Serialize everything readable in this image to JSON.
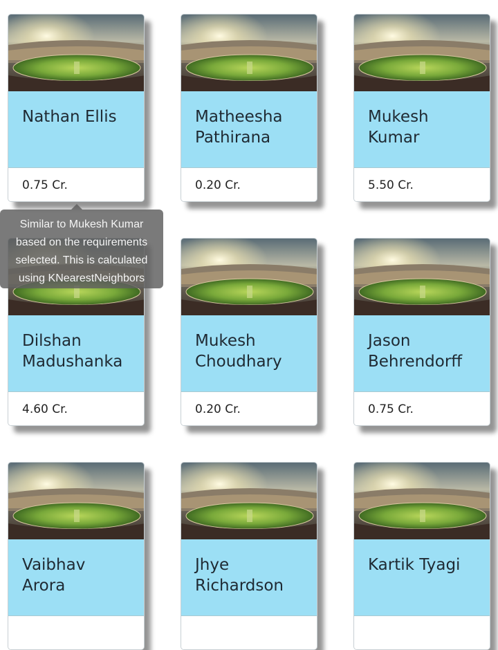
{
  "cards": [
    {
      "name": "Nathan Ellis",
      "price": "0.75 Cr.",
      "image": "stadium-image"
    },
    {
      "name": "Matheesha Pathirana",
      "price": "0.20 Cr.",
      "image": "stadium-image"
    },
    {
      "name": "Mukesh Kumar",
      "price": "5.50 Cr.",
      "image": "stadium-image"
    },
    {
      "name": "Dilshan Madushanka",
      "price": "4.60 Cr.",
      "image": "stadium-image"
    },
    {
      "name": "Mukesh Choudhary",
      "price": "0.20 Cr.",
      "image": "stadium-image"
    },
    {
      "name": "Jason Behrendorff",
      "price": "0.75 Cr.",
      "image": "stadium-image"
    },
    {
      "name": "Vaibhav Arora",
      "price": "",
      "image": "stadium-image"
    },
    {
      "name": "Jhye Richardson",
      "price": "",
      "image": "stadium-image"
    },
    {
      "name": "Kartik Tyagi",
      "price": "",
      "image": "stadium-image"
    }
  ],
  "tooltip": {
    "text": "Similar to Mukesh Kumar based on the requirements selected. This is calculated using KNearestNeighbors"
  },
  "colors": {
    "card_body": "#9cdff5",
    "tooltip_bg": "#5f5f5f"
  }
}
